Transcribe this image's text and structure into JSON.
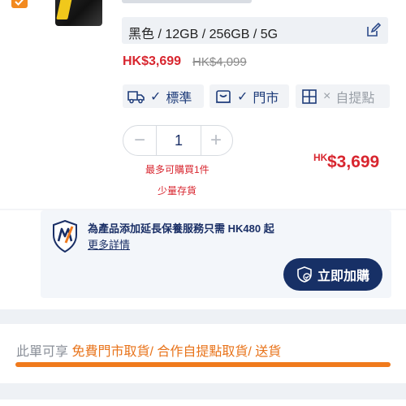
{
  "product": {
    "variant": "黑色 / 12GB / 256GB / 5G",
    "price_now": "HK$3,699",
    "price_old": "HK$4,099"
  },
  "delivery_chips": [
    {
      "label": "標準",
      "mark": "✓",
      "icon": "truck-icon",
      "enabled": true
    },
    {
      "label": "門市",
      "mark": "✓",
      "icon": "shop-bag-icon",
      "enabled": true
    },
    {
      "label": "自提點",
      "mark": "×",
      "icon": "locker-icon",
      "enabled": false
    }
  ],
  "quantity": {
    "minus": "−",
    "value": "1",
    "plus": "+",
    "max_note": "最多可購買1件",
    "stock_note": "少量存貨"
  },
  "total": {
    "currency": "HK",
    "amount": "$3,699"
  },
  "warranty": {
    "title": "為產品添加延長保養服務只需 HK480 起",
    "link": "更多詳情",
    "button": "立即加購"
  },
  "delivery_info": {
    "prefix": "此單可享",
    "options": "免費門市取貨/ 合作自提點取貨/ 送貨"
  },
  "colors": {
    "accent_red": "#d8262f",
    "brand_navy": "#173066",
    "orange": "#f07a1c"
  }
}
